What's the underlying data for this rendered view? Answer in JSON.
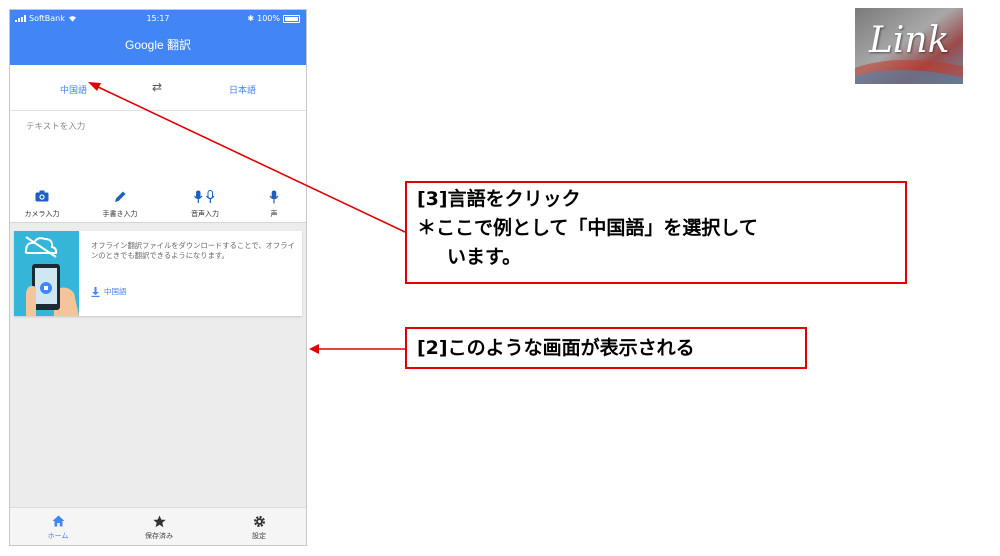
{
  "status_bar": {
    "carrier": "SoftBank",
    "time": "15:17",
    "battery": "100%"
  },
  "app": {
    "title": "Google 翻訳"
  },
  "languages": {
    "source": "中国語",
    "target": "日本語",
    "swap_icon": "swap-arrows-icon"
  },
  "input": {
    "placeholder": "テキストを入力"
  },
  "tools": [
    {
      "label": "カメラ入力",
      "icon": "camera-icon"
    },
    {
      "label": "手書き入力",
      "icon": "pen-icon"
    },
    {
      "label": "音声入力",
      "icon": "mic-pair-icon"
    },
    {
      "label": "声",
      "icon": "mic-icon"
    }
  ],
  "offline_card": {
    "text": "オフライン翻訳ファイルをダウンロードすることで、オフラインのときでも翻訳できるようになります。",
    "download_label": "中国語"
  },
  "bottom_nav": [
    {
      "label": "ホーム",
      "icon": "home-icon",
      "active": true
    },
    {
      "label": "保存済み",
      "icon": "star-icon",
      "active": false
    },
    {
      "label": "設定",
      "icon": "gear-icon",
      "active": false
    }
  ],
  "logo": {
    "text": "Link"
  },
  "callouts": {
    "step3": {
      "line1": "[3]言語をクリック",
      "line2": "＊ここで例として「中国語」を選択して",
      "line3": "います。"
    },
    "step2": {
      "line1": "[2]このような画面が表示される"
    }
  },
  "colors": {
    "accent": "#4285f4",
    "callout_red": "#e00000"
  }
}
